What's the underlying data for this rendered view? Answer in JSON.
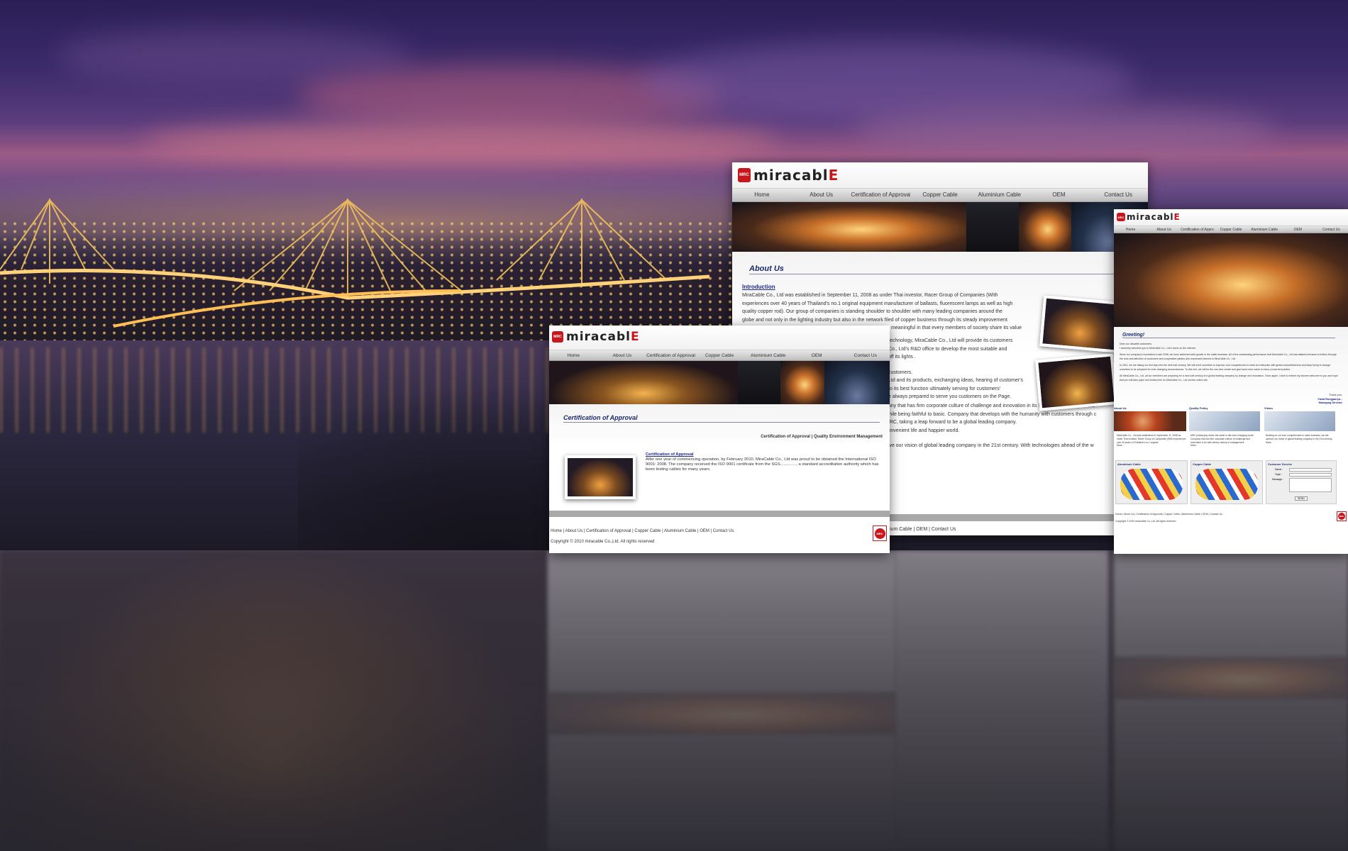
{
  "site_front": {
    "logo": "miracable",
    "nav": [
      "Home",
      "About Us",
      "Certification of Approval",
      "Copper Cable",
      "Aluminium Cable",
      "OEM",
      "Contact Us"
    ],
    "section_title": "Certification of Approval",
    "sub_nav": "Certification of Approval | Quality Environment Management",
    "link_title": "Certification of Approval",
    "body": "After one year of commencing operation, by February 2010, MiraCable Co., Ltd was proud to be obtained the International ISO 9001: 2008. The company received the ISO 9001 certificate from the SGS.............., a standard accreditation authority which has been testing cables for many years.",
    "footer_links": "Home | About Us | Certification of Approval | Copper Cable | Aluminium Cable | OEM | Contact Us",
    "copyright": "Copyright © 2010 miracable Co.,Ltd. All rights reserved",
    "stamp": "MRC"
  },
  "site_mid": {
    "logo": "miracable",
    "nav": [
      "Home",
      "About Us",
      "Certification of Approval",
      "Copper Cable",
      "Aluminium Cable",
      "OEM",
      "Contact Us"
    ],
    "section_title": "About Us",
    "intro_title": "Introduction",
    "paragraphs": [
      "MiraCable Co., Ltd was established in September 11, 2008 as under Thai investor, Racer Group of Companies (With",
      "experiences over 40 years of Thailand's no.1 original equipment manufacturer of ballasts, fluorescent lamps as well as high",
      "quality copper rod). Our group of companies is standing shoulder to shoulder with many leading companies around the",
      "globe and not only in the lighting industry but also in the network filed of copper business through its steady improvement",
      "meaningful in that every members of society share its value",
      "technology, MiraCable Co., Ltd will provide its customers",
      "Co., Ltd's R&D office to develop the most suitable and",
      "off its lights .",
      "customers.",
      "Ltd and its products, exchanging ideas, hearing of customer's",
      "to its best function ultimately serving for customers'",
      "e always prepared to serve you customers on the Page.",
      "pany that has firm corporate culture of challenge and innovation in its half-century history of this",
      "while being faithful to basic. Company that develops with the humanity with customers through c",
      "MRC, taking a leap forward to be a global leading company.",
      "convenient life and happier world.",
      "ieve our vision of global leading company in the 21st century. With technologies ahead of the w"
    ],
    "footer_links": "ium Cable | OEM | Contact Us"
  },
  "site_back": {
    "logo": "miracable",
    "nav": [
      "Home",
      "About Us",
      "Certification of Approval",
      "Copper Cable",
      "Aluminium Cable",
      "OEM",
      "Contact Us"
    ],
    "greeting_title": "Greeting!",
    "greeting_lines": [
      "Dear our valuable customers,",
      "I sincerely welcome you to MiraCable Co., Ltd's home on the internet.",
      "Since our company's foundation in late 2008, we have achieved solid growth in the cable business. All of the outstanding performance that MiraCable Co., Ltd has attained became to fruition through the trust and affection of customers and cooperative parties who expressed interest in MiraCable Co., Ltd.",
      "In 2011, we are taking our first step into the next half century. We will exert ourselves to improve core competencies to build an enterprise with global competitiveness and keep trying to change ourselves to be prepared for ever-changing circumstances. To this end, we will be the one who create and give back more value to every concerned parties.",
      "All MiraCable Co., Ltd, all our members are preparing for a new half-century of a global leading company by change and innovation. Once again, I wish to extend my sincere welcome to you and hope that you will take joyful and fruitful time for MiraCable Co., Ltd via this online site."
    ],
    "signature": [
      "Thank you,",
      "Viwat Rungpanya...",
      "Managing Director"
    ],
    "columns": [
      "About Us",
      "Quality Policy",
      "Vision"
    ],
    "col_texts": [
      "MiraCable Co., Ltd was established in September 11, 2008 as under Thai investor, Racer Group of Companies (With experiences over 40 years of Thailand's no.1 original",
      "MRC philosophy drives the same in this ever-changing world. Company that has firm corporate culture of challenge and innovation in its half-century history of management",
      "Building on our core competencies in cable business, we will achieve our vision of global leading company in the 21st century."
    ],
    "more": "More...",
    "products": [
      "Aluminium Cable",
      "Copper Cable",
      "Customer Service"
    ],
    "form_labels": [
      "Name :",
      "Topic :",
      "Message :"
    ],
    "send": "SEND",
    "footer_links": "Home | About Us | Certification of Approval | Copper Cable | Aluminium Cable | OEM | Contact Us",
    "copyright": "Copyright © 2010 miracable Co.,Ltd. All rights reserved"
  }
}
